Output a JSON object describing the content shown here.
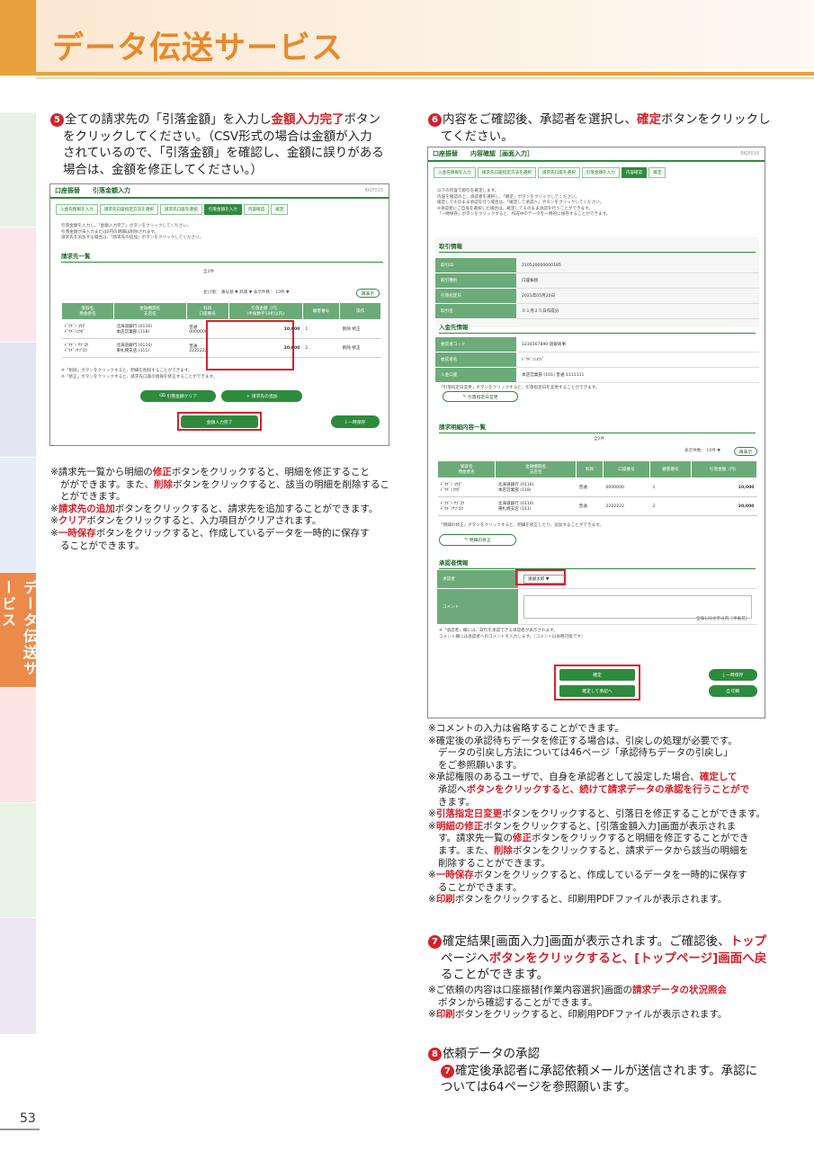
{
  "header": {
    "title": "データ伝送サービス"
  },
  "sidebar": {
    "active_tab": "データ伝送サービス"
  },
  "page_number": "53",
  "step5": {
    "num": "5",
    "lines": [
      [
        "全ての請求先の「引落金額」を入力し",
        "金額入力完了",
        "ボタン"
      ],
      [
        "をクリックしてください。（CSV形式の場合は金額が入力"
      ],
      [
        "されているので、「引落金額」を確認し、金額に誤りがある"
      ],
      [
        "場合は、金額を修正してください。）"
      ]
    ],
    "notes": [
      [
        "※請求先一覧から明細の",
        "修正",
        "ボタンをクリックすると、明細を修正すること"
      ],
      [
        "がができます。また、",
        "削除",
        "ボタンをクリックすると、該当の明細を削除するこ"
      ],
      [
        "とができます。"
      ],
      [
        "※",
        "請求先の追加",
        "ボタンをクリックすると、請求先を追加することができます。"
      ],
      [
        "※",
        "クリア",
        "ボタンをクリックすると、入力項目がクリアされます。"
      ],
      [
        "※",
        "一時保存",
        "ボタンをクリックすると、作成しているデータを一時的に保存す"
      ],
      [
        "ることができます。"
      ]
    ]
  },
  "shot5": {
    "title": "口座振替　　引落金額入力",
    "screen_id": "BKJF015",
    "steps": [
      "入金先情報を入力",
      "請求先口座指定方法を選択",
      "請求先口座を選択",
      "引落金額を入力",
      "内容確認",
      "確定"
    ],
    "active_step": 3,
    "intro": [
      "引落金額を入力し、「金額入力完了」ボタンをクリックしてください。",
      "引落金額が未入力または0円の明細は削除されます。",
      "請求先を追加する場合は、「請求先の追加」ボタンをクリックしてください。"
    ],
    "section": "請求先一覧",
    "count": "全2件",
    "sort": "並び順：  番号順  ▼   昇順  ▼    表示件数：  10件  ▼",
    "redisplay": "再表示",
    "columns": [
      "受取名\n預金者名",
      "金融機関名\n支店名",
      "科目\n口座番号",
      "引落金額（円）\n(半角数字10桁以内)",
      "顧客番号",
      "操作"
    ],
    "rows": [
      [
        "ﾄﾞｳｷﾞﾝ ｺｳﾀﾞ\nﾄﾞｳｷﾞﾝｺｳﾀﾞ",
        "北海道銀行 (0116)\n本店営業部 (118)",
        "普通\n0000000",
        "10,000",
        "1",
        "削除 修正"
      ],
      [
        "ﾄﾞｳｷﾞﾝ ｻﾌﾞﾛｳ\nﾄﾞｳｷﾞﾝｻﾌﾞﾛｳ",
        "北海道銀行 (0116)\n東札幌支店 (111)",
        "普通\n2222222",
        "20,000",
        "2",
        "削除 修正"
      ]
    ],
    "footnotes": [
      "※「削除」ボタンをクリックすると、明細を削除することができます。",
      "※「修正」ボタンをクリックすると、請求先口座の情報を修正することができます。"
    ],
    "btn_clear": "引落金額クリア",
    "btn_add": "請求先の追加",
    "btn_done": "金額入力完了",
    "btn_save": "一時保存"
  },
  "step6": {
    "num": "6",
    "lines": [
      [
        "内容をご確認後、承認者を選択し、",
        "確定",
        "ボタンをクリックし"
      ],
      [
        "てください。"
      ]
    ],
    "notes": [
      [
        "※コメントの入力は省略することができます。"
      ],
      [
        "※確定後の承認待ちデータを修正する場合は、引戻しの処理が必要です。"
      ],
      [
        "データの引戻し方法については46ページ「承認待ちデータの引戻し」"
      ],
      [
        "をご参照願います。"
      ],
      [
        "※承認権限のあるユーザで、自身を承認者として設定した場合、",
        "確定して"
      ],
      [
        "承認へ",
        "ボタンをクリックすると、続けて請求データの承認を行うことがで"
      ],
      [
        "きます。"
      ],
      [
        "※",
        "引落指定日変更",
        "ボタンをクリックすると、引落日を修正することができます。"
      ],
      [
        "※",
        "明細の修正",
        "ボタンをクリックすると、[引落金額入力]画面が表示されま"
      ],
      [
        "す。請求先一覧の",
        "修正",
        "ボタンをクリックすると明細を修正することができ"
      ],
      [
        "ます。また、",
        "削除",
        "ボタンをクリックすると、請求データから該当の明細を"
      ],
      [
        "削除することができます。"
      ],
      [
        "※",
        "一時保存",
        "ボタンをクリックすると、作成しているデータを一時的に保存す"
      ],
      [
        "ることができます。"
      ],
      [
        "※",
        "印刷",
        "ボタンをクリックすると、印刷用PDFファイルが表示されます。"
      ]
    ]
  },
  "shot6": {
    "title": "口座振替　　内容確認［画面入力］",
    "screen_id": "BKJF016",
    "steps": [
      "入金先情報を入力",
      "請求先口座指定方法を選択",
      "請求先口座を選択",
      "引落金額を入力",
      "内容確認",
      "確定"
    ],
    "active_step": 4,
    "intro": [
      "以下の内容で取引を確定します。",
      "内容を確認の上、承認者を選択し、「確定」ボタンをクリックしてください。",
      "確定してそのまま承認を行う場合は、「確定して承認へ」ボタンをクリックしてください。",
      "※承認者にご自身を選択した場合は、確定してそのまま承認を行うことができます。",
      "「一時保存」ボタンをクリックすると、作成中のデータを一時的に保存することができます。"
    ],
    "sec_trade": "取引情報",
    "trade": [
      [
        "取引ID",
        "210520000000185"
      ],
      [
        "取引種別",
        "口座振替"
      ],
      [
        "引落指定日",
        "2021年05月20日"
      ],
      [
        "取引名",
        "０１月２５日作成分"
      ]
    ],
    "sec_payee": "入金先情報",
    "payee": [
      [
        "委託者コード",
        "1234567890 道銀商事"
      ],
      [
        "委託者名",
        "ﾄﾞｳｷﾞﾝｼｮｳｼﾞ"
      ],
      [
        "入金口座",
        "本店営業部 (101)  普通    1111111"
      ]
    ],
    "payee_note": "「引落指定日変更」ボタンをクリックすると、引落指定日を変更することができます。",
    "btn_change_date": "引落指定日変更",
    "sec_detail": "請求明細内容一覧",
    "count": "全2件",
    "per_page": "表示件数：  10件  ▼",
    "redisplay": "再表示",
    "columns": [
      "受取名\n預金者名",
      "金融機関名\n支店名",
      "科目",
      "口座番号",
      "顧客番号",
      "引落金額（円）"
    ],
    "rows": [
      [
        "ﾄﾞｳｷﾞﾝ ｺｳﾀﾞ\nﾄﾞｳｷﾞﾝｺｳﾀﾞ",
        "北海道銀行 (0116)\n本店営業部 (118)",
        "普通",
        "0000000",
        "1",
        "10,000"
      ],
      [
        "ﾄﾞｳｷﾞﾝ ｻﾌﾞﾛｳ\nﾄﾞｳｷﾞﾝｻﾌﾞﾛｳ",
        "北海道銀行 (0116)\n東札幌支店 (111)",
        "普通",
        "2222222",
        "2",
        "20,000"
      ]
    ],
    "detail_note": "「明細の修正」ボタンをクリックすると、明細を修正したり、追加することができます。",
    "btn_edit": "明細の修正",
    "sec_approver": "承認者情報",
    "approver_label": "承認者",
    "approver_value": "道銀太郎",
    "comment_label": "コメント",
    "comment_limit": "全角120文字以内［半角可］",
    "approver_note": [
      "※「承認者」欄には、取引を承認できる承認者が表示されます。",
      "コメント欄には承認者へのコメントを入力します。（コメントは省略可能です）"
    ],
    "btn_confirm": "確定",
    "btn_confirm_approve": "確定して承認へ",
    "btn_save": "一時保存",
    "btn_print": "印刷"
  },
  "step7": {
    "num": "7",
    "lines": [
      [
        "確定結果[画面入力]画面が表示されます。ご確認後、",
        "トップ"
      ],
      [
        "ページへ",
        "ボタンをクリックすると、[トップページ]画面へ戻"
      ],
      [
        "ることができます。"
      ]
    ],
    "notes": [
      [
        "※ご依頼の内容は口座振替[作業内容選択]画面の",
        "請求データの状況照会"
      ],
      [
        "ボタンから確認することができます。"
      ],
      [
        "※",
        "印刷",
        "ボタンをクリックすると、印刷用PDFファイルが表示されます。"
      ]
    ]
  },
  "step8": {
    "num": "8",
    "title": "依頼データの承認",
    "sub_num": "7",
    "lines": [
      [
        "確定後承認者に承認依頼メールが送信されます。承認に"
      ],
      [
        "ついては64ページを参照願います。"
      ]
    ]
  }
}
